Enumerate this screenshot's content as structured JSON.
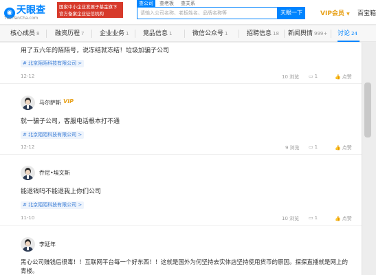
{
  "header": {
    "logo_title": "天眼查",
    "logo_subtitle": "TianYanCha.com",
    "gov_badge_line1": "国家中小企业发展子基金旗下",
    "gov_badge_line2": "官方备案企业征信机构",
    "search_tabs": [
      "查公司",
      "查老板",
      "查关系"
    ],
    "search_placeholder": "请输入公司名称、老板姓名、品牌名称等",
    "search_button": "天眼一下",
    "vip_label": "VIP会员",
    "baibao_label": "百宝箱"
  },
  "nav": {
    "items": [
      {
        "label": "核心成员",
        "count": "8"
      },
      {
        "label": "融资历程",
        "count": "7"
      },
      {
        "label": "企业业务",
        "count": "1"
      },
      {
        "label": "竞品信息",
        "count": "1"
      },
      {
        "label": "微信公众号",
        "count": "1"
      },
      {
        "label": "招聘信息",
        "count": "18"
      },
      {
        "label": "新闻舆情",
        "count": "999+"
      },
      {
        "label": "讨论",
        "count": "24"
      }
    ],
    "active_index": 7
  },
  "posts": [
    {
      "author": "",
      "vip": false,
      "text": "用了五六年的陌陌号，说冻结就冻结！垃圾加骗子公司",
      "tag": "# 北京陌陌科技有限公司 >",
      "date": "12-12",
      "views": "10 浏览",
      "replies": "1",
      "likes": "点赞"
    },
    {
      "author": "马尔萨斯",
      "vip": true,
      "vip_label": "VIP",
      "text": "就一骗子公司，客服电话根本打不通",
      "tag": "# 北京陌陌科技有限公司 >",
      "date": "12-12",
      "views": "9 浏览",
      "replies": "1",
      "likes": "点赞"
    },
    {
      "author": "乔尼•埃文斯",
      "vip": false,
      "text": "能退钱吗不能退我上你们公司",
      "tag": "# 北京陌陌科技有限公司 >",
      "date": "11-10",
      "views": "10 浏览",
      "replies": "1",
      "likes": "点赞"
    },
    {
      "author": "李延年",
      "vip": false,
      "text": "黑心公司赚钱后很毒！！互联网平台每一个好东西！！这就是国外为何坚持去实体店坚持使用货币的原因。探探直播就是网上的",
      "text2": "青楼。"
    }
  ],
  "colors": {
    "brand": "#0084ff",
    "vip": "#e8a21b",
    "gov_badge": "#d73a2b",
    "tag_text": "#3f7fd6"
  }
}
